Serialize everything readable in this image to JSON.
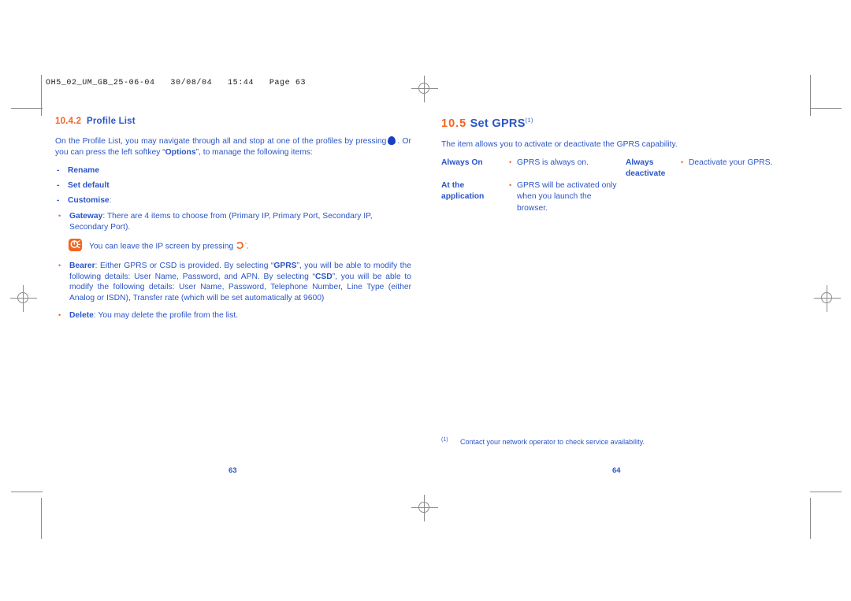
{
  "print_slug": "OH5_02_UM_GB_25-06-04   30/08/04   15:44   Page 63",
  "left_page": {
    "section": {
      "number": "10.4.2",
      "title": "Profile List"
    },
    "intro_part1": "On the Profile List, you may navigate through all and stop at one of the profiles by pressing",
    "intro_glyph": "ok-key-glyph",
    "intro_part2": ". Or you can press the left softkey “",
    "intro_bold": "Options",
    "intro_part3": "”, to manage the following items:",
    "options": [
      {
        "label": "Rename",
        "suffix": ""
      },
      {
        "label": "Set default",
        "suffix": ""
      },
      {
        "label": "Customise",
        "suffix": ":"
      }
    ],
    "customise_items": [
      {
        "term": "Gateway",
        "text": ": There are 4 items to choose from (Primary IP, Primary Port, Secondary IP, Secondary Port)."
      }
    ],
    "tip": {
      "icon": "tip-bulb-icon",
      "text_before": "You can leave the IP screen by pressing",
      "glyph": "c-key-glyph",
      "text_after": "."
    },
    "bearer": {
      "term": "Bearer",
      "seg1": ": Either GPRS or CSD is provided. By selecting “",
      "bold1": "GPRS",
      "seg2": "”, you will be able to modify the following details: User Name, Password, and APN. By selecting “",
      "bold2": "CSD",
      "seg3": "”, you will be able to modify the following details: User Name, Password, Telephone Number, Line Type (either Analog or ISDN), Transfer rate (which will be set automatically at 9600)"
    },
    "delete": {
      "term": "Delete",
      "text": ": You may delete the profile from the list."
    },
    "folio": "63"
  },
  "right_page": {
    "section": {
      "number": "10.5",
      "title": "Set GPRS",
      "footnote_mark": "(1)"
    },
    "intro": "The item allows you to activate or deactivate the GPRS capability.",
    "table": {
      "rows": [
        {
          "option": "Always On",
          "desc": "GPRS is always on.",
          "desc_cont": "",
          "option2": "Always",
          "option2_cont": "deactivate",
          "desc2": "Deactivate your GPRS."
        },
        {
          "option": "At the",
          "option_cont": "application",
          "desc": "GPRS will be activated only",
          "desc_cont": "when you launch the browser.",
          "option2": "",
          "option2_cont": "",
          "desc2": ""
        }
      ]
    },
    "footnote": {
      "mark": "(1)",
      "text": "Contact your network operator to check service availability."
    },
    "folio": "64"
  }
}
